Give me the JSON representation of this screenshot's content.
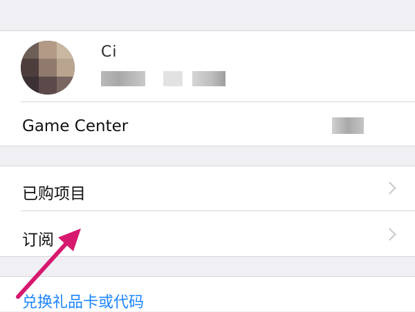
{
  "account": {
    "name_partial": "Ci",
    "game_center_label": "Game Center"
  },
  "sections": {
    "purchased_label": "已购项目",
    "subscriptions_label": "订阅"
  },
  "redeem": {
    "link_label": "兑换礼品卡或代码"
  },
  "colors": {
    "background": "#efeff4",
    "link": "#1a84ff",
    "annotation_arrow": "#d6196e",
    "separator": "#d6d6da",
    "chevron": "#c7c7cc"
  },
  "icons": {
    "chevron": "chevron-right-icon",
    "annotation": "arrow-annotation-icon"
  }
}
